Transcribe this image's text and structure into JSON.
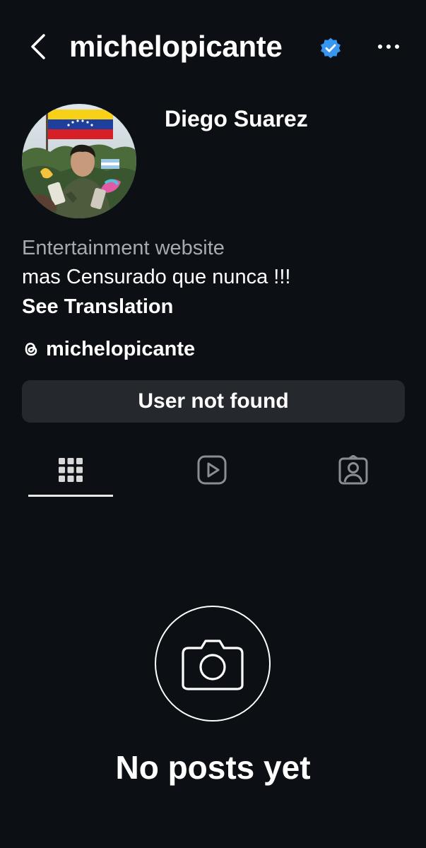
{
  "header": {
    "username": "michelopicante",
    "verified": true,
    "back_icon": "chevron-left-icon",
    "more_icon": "more-horizontal-icon"
  },
  "profile": {
    "display_name": "Diego Suarez",
    "category": "Entertainment website",
    "bio": "mas Censurado que nunca !!!",
    "see_translation": "See Translation",
    "threads_handle": "michelopicante"
  },
  "status": {
    "text": "User not found"
  },
  "tabs": [
    {
      "name": "posts-grid",
      "icon": "grid-icon",
      "active": true
    },
    {
      "name": "reels",
      "icon": "reels-icon",
      "active": false
    },
    {
      "name": "tagged",
      "icon": "tagged-icon",
      "active": false
    }
  ],
  "empty_state": {
    "icon": "camera-icon",
    "text": "No posts yet"
  },
  "colors": {
    "background": "#0c1014",
    "secondary_text": "#a8a8b3",
    "verified_blue": "#3797f0",
    "status_box": "#25292e"
  }
}
